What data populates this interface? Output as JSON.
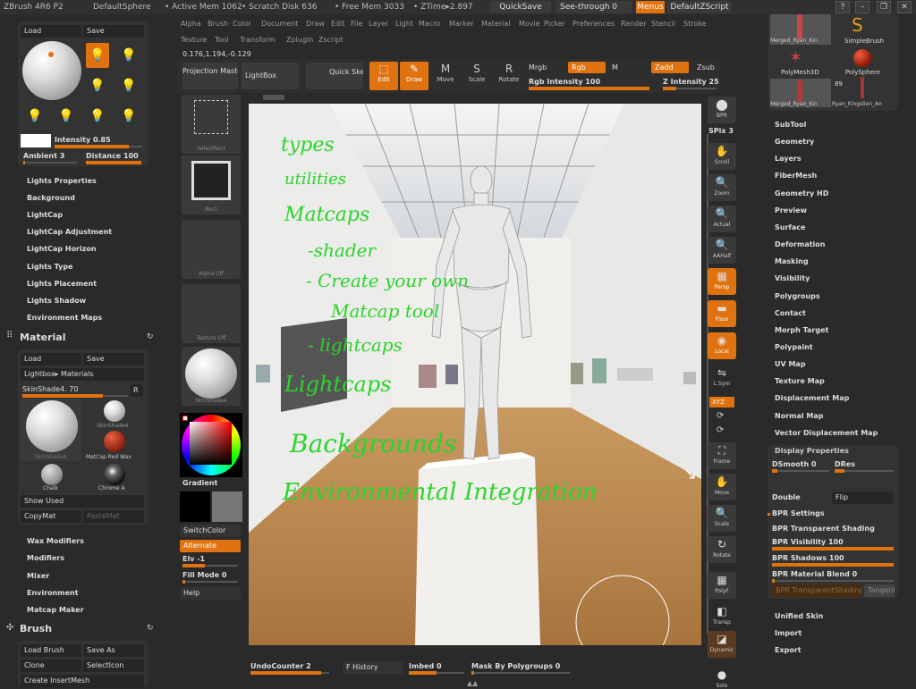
{
  "titlebar": {
    "app": "ZBrush 4R6 P2",
    "document": "DefaultSphere",
    "active_mem": "• Active Mem 1062",
    "scratch_disk": "• Scratch Disk 636",
    "free_mem": "• Free Mem 3033",
    "ztime": "• ZTime▸2.897",
    "quicksave": "QuickSave",
    "seethrough": "See-through 0",
    "menus": "Menus",
    "script": "DefaultZScript"
  },
  "menubar": {
    "row1": [
      "Alpha",
      "Brush",
      "Color",
      "Document",
      "Draw",
      "Edit",
      "File",
      "Layer",
      "Light",
      "Macro",
      "Marker",
      "Material",
      "Movie",
      "Picker",
      "Preferences",
      "Render",
      "Stencil",
      "Stroke"
    ],
    "row2": [
      "Texture",
      "Tool",
      "Transform",
      "Zplugin",
      "Zscript"
    ],
    "coords": "0.176,1.194,-0.129"
  },
  "toolbar": {
    "projection_master": "Projection Master",
    "lightbox": "LightBox",
    "quick_sketch": "Quick Sketch",
    "edit": "Edit",
    "draw": "Draw",
    "move": "Move",
    "scale": "Scale",
    "rotate": "Rotate",
    "mrgb": "Mrgb",
    "rgb": "Rgb",
    "m": "M",
    "rgb_intensity": "Rgb Intensity 100",
    "zadd": "Zadd",
    "zsub": "Zsub",
    "z_intensity": "Z Intensity 25"
  },
  "light_panel": {
    "load": "Load",
    "save": "Save",
    "intensity": "Intensity 0.85",
    "ambient": "Ambient 3",
    "distance": "Distance 100",
    "intensity_level": 0.85,
    "ambient_level": 0.03,
    "distance_level": 1.0
  },
  "light_menu": [
    "Lights Properties",
    "Background",
    "LightCap",
    "LightCap Adjustment",
    "LightCap Horizon",
    "Lights Type",
    "Lights Placement",
    "Lights Shadow",
    "Environment Maps"
  ],
  "material": {
    "title": "Material",
    "load": "Load",
    "save": "Save",
    "lightbox_materials": "Lightbox▸ Materials",
    "current": "SkinShade4. 70",
    "r": "R",
    "thumb_skinshade": "SkinShade4",
    "thumb_matcap": "MatCap Red Wax",
    "thumb_chalk": "Chalk",
    "thumb_chrome": "Chrome A",
    "thumb_main": "SkinShade4",
    "show_used": "Show Used",
    "copymat": "CopyMat",
    "pastemat": "PasteMat",
    "items": [
      "Wax Modifiers",
      "Modifiers",
      "Mixer",
      "Environment",
      "Matcap Maker"
    ]
  },
  "brush": {
    "title": "Brush",
    "load_brush": "Load Brush",
    "save_as": "Save As",
    "clone": "Clone",
    "select_icon": "SelectIcon",
    "create_insertmesh": "Create InsertMesh"
  },
  "shelf": {
    "select_rect": "SelectRect",
    "rect": "Rect",
    "alpha_off": "Alpha Off",
    "texture_off": "Texture Off",
    "skinshade": "SkinShade4",
    "gradient": "Gradient",
    "switch_color": "SwitchColor",
    "alternate": "Alternate",
    "elv": "Elv -1",
    "fill_mode": "Fill Mode 0",
    "help": "Help"
  },
  "right_shelf": {
    "bpr": "BPR",
    "spix": "SPix 3",
    "scroll": "Scroll",
    "zoom": "Zoom",
    "actual": "Actual",
    "aahalf": "AAHalf",
    "persp": "Persp",
    "floor": "Floor",
    "local": "Local",
    "lsym": "L.Sym",
    "xyz": "XYZ",
    "frame": "Frame",
    "move": "Move",
    "scale": "Scale",
    "rotate": "Rotate",
    "polyf": "PolyF",
    "transp": "Transp",
    "dynamic": "Dynamic",
    "solo": "Solo"
  },
  "tool_panel": {
    "thumb1": "Merged_Ryan_Kin",
    "thumb2": "SimpleBrush",
    "thumb3": "PolyMesh3D",
    "thumb4": "PolySphere",
    "thumb5": "Merged_Ryan_Kin",
    "thumb6": "Ryan_Kingslien_An",
    "count": "89",
    "items": [
      "SubTool",
      "Geometry",
      "Layers",
      "FiberMesh",
      "Geometry HD",
      "Preview",
      "Surface",
      "Deformation",
      "Masking",
      "Visibility",
      "Polygroups",
      "Contact",
      "Morph Target",
      "Polypaint",
      "UV Map",
      "Texture Map",
      "Displacement Map",
      "Normal Map",
      "Vector Displacement Map"
    ],
    "display_properties": "Display Properties",
    "dsmooth": "DSmooth 0",
    "dres": "DRes",
    "double": "Double",
    "flip": "Flip",
    "bpr_settings": "BPR Settings",
    "bpr_transparent": "BPR Transparent Shading",
    "bpr_visibility": "BPR Visibility 100",
    "bpr_shadows": "BPR Shadows 100",
    "bpr_material_blend": "BPR Material Blend 0",
    "bpr_transparent_shading": "BPR TransparentShading",
    "tangent": "Tangent",
    "unified_skin": "Unified Skin",
    "import": "Import",
    "export": "Export"
  },
  "bottom": {
    "undo": "UndoCounter 2",
    "history": "F History",
    "imbed": "Imbed 0",
    "mask_polygroups": "Mask By Polygroups 0"
  },
  "handwriting": [
    "types",
    "utilities",
    "Matcaps",
    "-shader",
    "- Create your own",
    "Matcap tool",
    "- lightcaps",
    "Lightcaps",
    "Backgrounds",
    "Environmental Integration"
  ],
  "colors": {
    "accent": "#e0730f",
    "ink": "#2bd42b",
    "panel": "#333333",
    "bg": "#2a2a2a"
  }
}
